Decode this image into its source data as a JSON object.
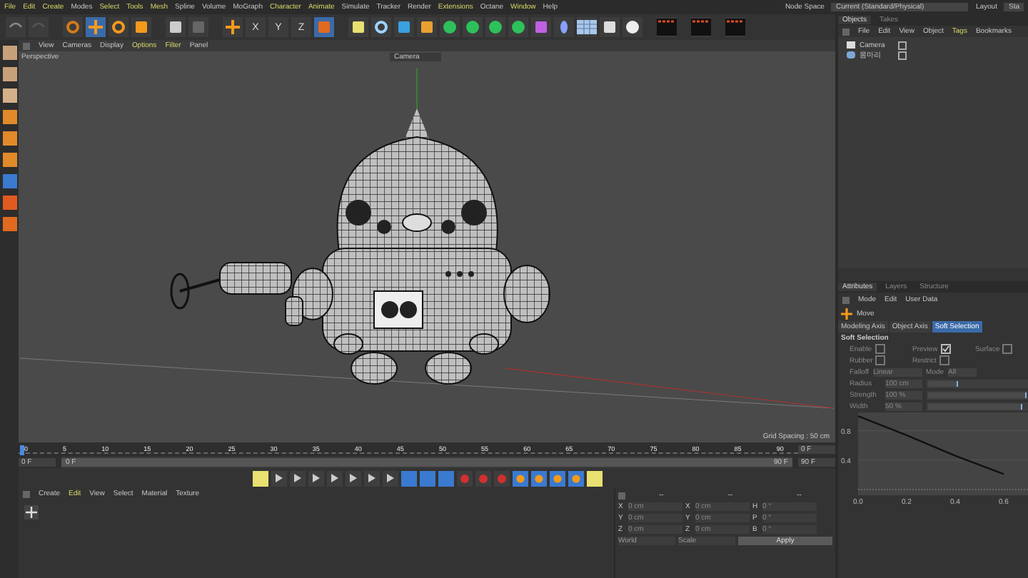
{
  "menu": [
    {
      "label": "File",
      "highlighted": true
    },
    {
      "label": "Edit",
      "highlighted": true
    },
    {
      "label": "Create",
      "highlighted": true
    },
    {
      "label": "Modes",
      "highlighted": false
    },
    {
      "label": "Select",
      "highlighted": true
    },
    {
      "label": "Tools",
      "highlighted": true
    },
    {
      "label": "Mesh",
      "highlighted": true
    },
    {
      "label": "Spline",
      "highlighted": false
    },
    {
      "label": "Volume",
      "highlighted": false
    },
    {
      "label": "MoGraph",
      "highlighted": false
    },
    {
      "label": "Character",
      "highlighted": true
    },
    {
      "label": "Animate",
      "highlighted": true
    },
    {
      "label": "Simulate",
      "highlighted": false
    },
    {
      "label": "Tracker",
      "highlighted": false
    },
    {
      "label": "Render",
      "highlighted": false
    },
    {
      "label": "Extensions",
      "highlighted": true
    },
    {
      "label": "Octane",
      "highlighted": false
    },
    {
      "label": "Window",
      "highlighted": true
    },
    {
      "label": "Help",
      "highlighted": false
    }
  ],
  "node_space": {
    "label": "Node Space",
    "value": "Current (Standard/Physical)"
  },
  "layout": {
    "label": "Layout",
    "value": "Sta"
  },
  "tools": [
    {
      "kind": "undo",
      "selected": false
    },
    {
      "kind": "redo",
      "selected": false
    },
    {
      "kind": "select",
      "selected": false
    },
    {
      "kind": "move",
      "selected": true
    },
    {
      "kind": "rotate",
      "selected": false
    },
    {
      "kind": "scale",
      "selected": false
    },
    {
      "kind": "transform",
      "selected": false
    },
    {
      "kind": "recent",
      "selected": false
    },
    {
      "kind": "add",
      "selected": false
    },
    {
      "kind": "axis",
      "label": "X",
      "selected": false
    },
    {
      "kind": "axis",
      "label": "Y",
      "selected": false
    },
    {
      "kind": "axis",
      "label": "Z",
      "selected": false
    },
    {
      "kind": "coords",
      "selected": true
    },
    {
      "kind": "render-view",
      "selected": false
    },
    {
      "kind": "sphere",
      "selected": false
    },
    {
      "kind": "cube",
      "selected": false
    },
    {
      "kind": "pen",
      "selected": false
    },
    {
      "kind": "generator",
      "selected": false
    },
    {
      "kind": "generator",
      "selected": false
    },
    {
      "kind": "generator",
      "selected": false
    },
    {
      "kind": "generator",
      "selected": false
    },
    {
      "kind": "bracket",
      "selected": false
    },
    {
      "kind": "capsule",
      "selected": false
    },
    {
      "kind": "grid",
      "selected": false
    },
    {
      "kind": "camera",
      "selected": false
    },
    {
      "kind": "bulb",
      "selected": false
    },
    {
      "kind": "clapper",
      "selected": false
    },
    {
      "kind": "clapper",
      "selected": false
    },
    {
      "kind": "clapper",
      "selected": false
    }
  ],
  "viewport": {
    "menu": [
      {
        "label": "View",
        "highlighted": false
      },
      {
        "label": "Cameras",
        "highlighted": false
      },
      {
        "label": "Display",
        "highlighted": false
      },
      {
        "label": "Options",
        "highlighted": true
      },
      {
        "label": "Filter",
        "highlighted": true
      },
      {
        "label": "Panel",
        "highlighted": false
      }
    ],
    "view_name": "Perspective",
    "camera": "Camera",
    "grid_spacing": "Grid Spacing : 50 cm"
  },
  "timeline": {
    "ticks": [
      "0",
      "5",
      "10",
      "15",
      "20",
      "25",
      "30",
      "35",
      "40",
      "45",
      "50",
      "55",
      "60",
      "65",
      "70",
      "75",
      "80",
      "85",
      "90"
    ],
    "current": "0 F",
    "range": {
      "start": "0 F",
      "end": "90 F",
      "level": 1
    },
    "end": "90 F",
    "end_field": "0 F"
  },
  "material_menu": [
    {
      "label": "Create",
      "highlighted": false
    },
    {
      "label": "Edit",
      "highlighted": true
    },
    {
      "label": "View",
      "highlighted": false
    },
    {
      "label": "Select",
      "highlighted": false
    },
    {
      "label": "Material",
      "highlighted": false
    },
    {
      "label": "Texture",
      "highlighted": false
    }
  ],
  "coordinates": {
    "headers": [
      "--",
      "--",
      "--"
    ],
    "rows": [
      {
        "axis": "X",
        "position": "0 cm",
        "size_axis": "X",
        "size": "0 cm",
        "rot_axis": "H",
        "rotation": "0 °"
      },
      {
        "axis": "Y",
        "position": "0 cm",
        "size_axis": "Y",
        "size": "0 cm",
        "rot_axis": "P",
        "rotation": "0 °"
      },
      {
        "axis": "Z",
        "position": "0 cm",
        "size_axis": "Z",
        "size": "0 cm",
        "rot_axis": "B",
        "rotation": "0 °"
      }
    ],
    "space": "World",
    "mode": "Scale",
    "apply": "Apply"
  },
  "objects": {
    "tabs": [
      {
        "label": "Objects",
        "selected": true
      },
      {
        "label": "Takes",
        "selected": false
      }
    ],
    "menu": [
      {
        "label": "File",
        "highlighted": false
      },
      {
        "label": "Edit",
        "highlighted": false
      },
      {
        "label": "View",
        "highlighted": false
      },
      {
        "label": "Object",
        "highlighted": false
      },
      {
        "label": "Tags",
        "highlighted": true
      },
      {
        "label": "Bookmarks",
        "highlighted": false
      }
    ],
    "items": [
      {
        "name": "Camera",
        "kind": "camera"
      },
      {
        "name": "몸마리",
        "kind": "object"
      }
    ]
  },
  "attributes": {
    "tabs": [
      {
        "label": "Attributes",
        "selected": true
      },
      {
        "label": "Layers",
        "selected": false
      },
      {
        "label": "Structure",
        "selected": false
      }
    ],
    "menu": [
      {
        "label": "Mode",
        "highlighted": false
      },
      {
        "label": "Edit",
        "highlighted": false
      },
      {
        "label": "User Data",
        "highlighted": false
      }
    ],
    "tool": "Move",
    "subtabs": [
      {
        "label": "Modeling Axis",
        "selected": false
      },
      {
        "label": "Object Axis",
        "selected": false
      },
      {
        "label": "Soft Selection",
        "selected": true
      }
    ],
    "section": "Soft Selection",
    "checks": [
      {
        "label": "Enable",
        "checked": false
      },
      {
        "label": "Preview",
        "checked": true
      },
      {
        "label": "Surface",
        "checked": false
      },
      {
        "label": "Rubber",
        "checked": false
      },
      {
        "label": "Restrict",
        "checked": false
      }
    ],
    "falloff": {
      "label": "Falloff",
      "value": "Linear"
    },
    "mode": {
      "label": "Mode",
      "value": "All"
    },
    "sliders": [
      {
        "label": "Radius",
        "value": "100 cm",
        "level": 0.3
      },
      {
        "label": "Strength",
        "value": "100 %",
        "level": 1
      },
      {
        "label": "Width",
        "value": "50 %",
        "level": 0.95
      }
    ],
    "chart_data": {
      "type": "line",
      "x": [
        0,
        0.2,
        0.4,
        0.6
      ],
      "xlim": [
        0,
        0.7
      ],
      "ylim": [
        0,
        1.05
      ],
      "series": [
        {
          "color": "#111111",
          "values": [
            1,
            0.74,
            0.46,
            0.21
          ]
        }
      ],
      "xticks": [
        {
          "value": 0,
          "label": "0.0"
        },
        {
          "value": 0.2,
          "label": "0.2"
        },
        {
          "value": 0.4,
          "label": "0.4"
        },
        {
          "value": 0.6,
          "label": "0.6"
        }
      ],
      "yticks": [
        {
          "value": 0.4,
          "label": "0.4"
        },
        {
          "value": 0.8,
          "label": "0.8"
        }
      ]
    }
  }
}
